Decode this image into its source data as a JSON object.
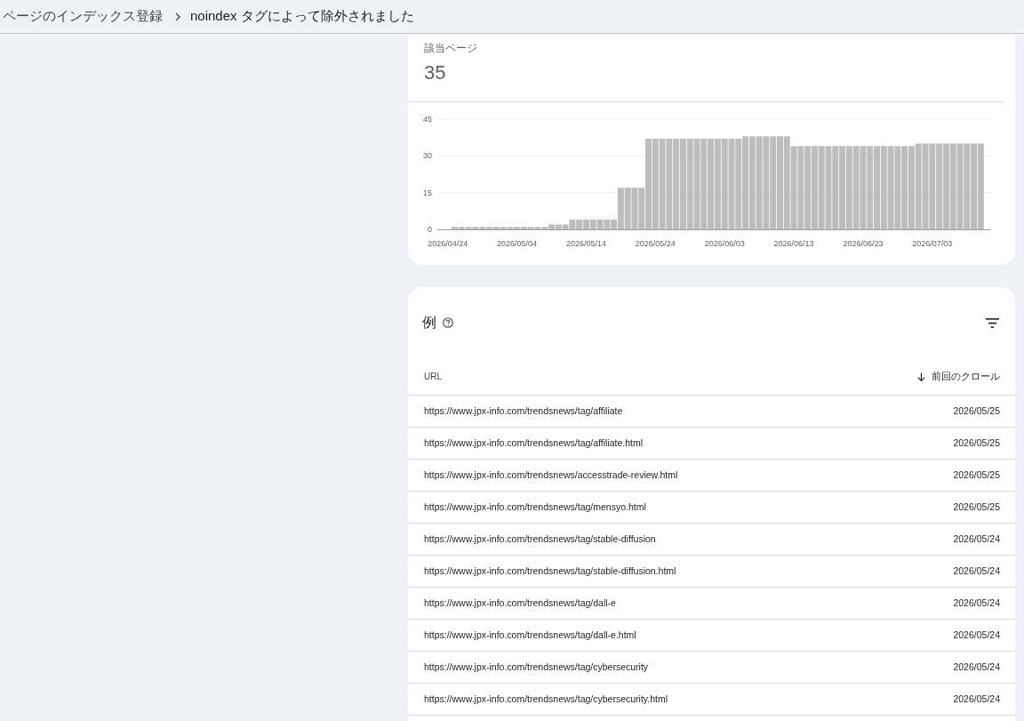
{
  "breadcrumb": [
    {
      "label": "ページのインデックス登録"
    },
    {
      "label": "noindex タグによって除外されました"
    }
  ],
  "summary": {
    "metric_label": "該当ページ",
    "metric_value": "35",
    "chart_data": {
      "type": "bar",
      "categories": [
        "2026/04/24",
        null,
        null,
        null,
        null,
        null,
        null,
        null,
        null,
        null,
        "2026/05/04",
        null,
        null,
        null,
        null,
        null,
        null,
        null,
        null,
        null,
        "2026/05/14",
        null,
        null,
        null,
        null,
        null,
        null,
        null,
        null,
        null,
        "2026/05/24",
        null,
        null,
        null,
        null,
        null,
        null,
        null,
        null,
        null,
        "2026/06/03",
        null,
        null,
        null,
        null,
        null,
        null,
        null,
        null,
        null,
        "2026/06/13",
        null,
        null,
        null,
        null,
        null,
        null,
        null,
        null,
        null,
        "2026/06/23",
        null,
        null,
        null,
        null,
        null,
        null,
        null,
        null,
        null,
        "2026/07/03",
        null,
        null,
        null,
        null,
        null,
        null,
        null
      ],
      "values": [
        0,
        1,
        1,
        1,
        1,
        1,
        1,
        1,
        1,
        1,
        1,
        1,
        1,
        1,
        1,
        2,
        2,
        2,
        4,
        4,
        4,
        4,
        4,
        4,
        4,
        17,
        17,
        17,
        17,
        37,
        37,
        37,
        37,
        37,
        37,
        37,
        37,
        37,
        37,
        37,
        37,
        37,
        37,
        38,
        38,
        38,
        38,
        38,
        38,
        38,
        34,
        34,
        34,
        34,
        34,
        34,
        34,
        34,
        34,
        34,
        34,
        34,
        34,
        34,
        34,
        34,
        34,
        34,
        35,
        35,
        35,
        35,
        35,
        35,
        35,
        35,
        35,
        35
      ],
      "ylim": [
        0,
        45
      ],
      "yticks": [
        0,
        15,
        30,
        45
      ]
    }
  },
  "examples": {
    "title": "例",
    "columns": [
      {
        "label": "URL",
        "sorted": false
      },
      {
        "label": "前回のクロール",
        "sorted": true
      }
    ],
    "rows": [
      {
        "url": "https://www.jpx-info.com/trendsnews/tag/affiliate",
        "last_crawl": "2026/05/25"
      },
      {
        "url": "https://www.jpx-info.com/trendsnews/tag/affiliate.html",
        "last_crawl": "2026/05/25"
      },
      {
        "url": "https://www.jpx-info.com/trendsnews/accesstrade-review.html",
        "last_crawl": "2026/05/25"
      },
      {
        "url": "https://www.jpx-info.com/trendsnews/tag/mensyo.html",
        "last_crawl": "2026/05/25"
      },
      {
        "url": "https://www.jpx-info.com/trendsnews/tag/stable-diffusion",
        "last_crawl": "2026/05/24"
      },
      {
        "url": "https://www.jpx-info.com/trendsnews/tag/stable-diffusion.html",
        "last_crawl": "2026/05/24"
      },
      {
        "url": "https://www.jpx-info.com/trendsnews/tag/dall-e",
        "last_crawl": "2026/05/24"
      },
      {
        "url": "https://www.jpx-info.com/trendsnews/tag/dall-e.html",
        "last_crawl": "2026/05/24"
      },
      {
        "url": "https://www.jpx-info.com/trendsnews/tag/cybersecurity",
        "last_crawl": "2026/05/24"
      },
      {
        "url": "https://www.jpx-info.com/trendsnews/tag/cybersecurity.html",
        "last_crawl": "2026/05/24"
      }
    ]
  }
}
